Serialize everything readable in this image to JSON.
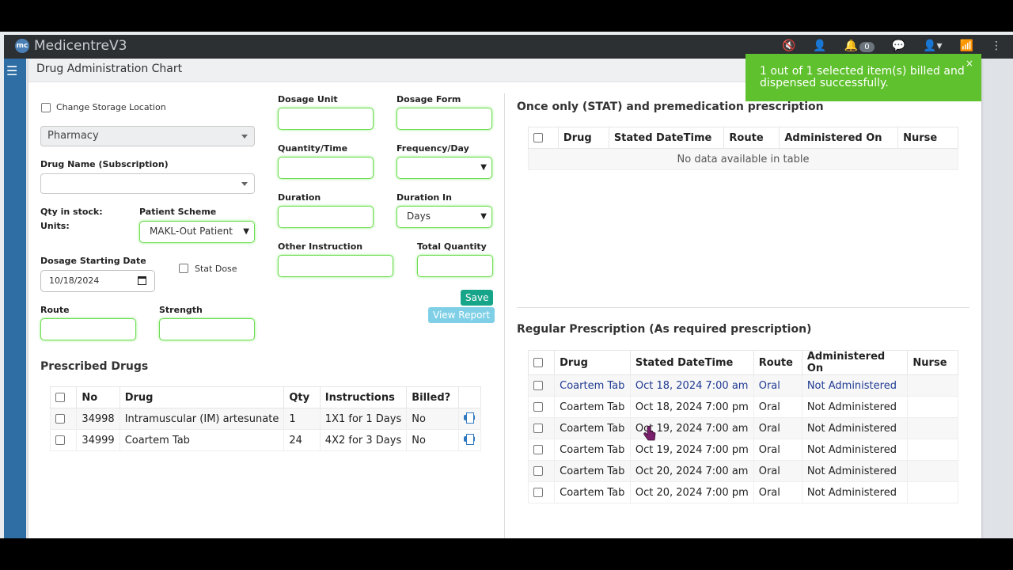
{
  "app": {
    "title": "MedicentreV3",
    "logo_text": "mc",
    "notification_count": "0"
  },
  "modal": {
    "title": "Drug Administration Chart"
  },
  "form": {
    "change_storage_label": "Change Storage Location",
    "store_value": "Pharmacy",
    "drug_name_label": "Drug Name (Subscription)",
    "qty_in_stock_label": "Qty in stock:",
    "units_label": "Units:",
    "patient_scheme_label": "Patient Scheme",
    "patient_scheme_value": "MAKL-Out Patient",
    "dosage_start_label": "Dosage Starting Date",
    "dosage_start_value": "10/18/2024",
    "stat_dose_label": "Stat Dose",
    "route_label": "Route",
    "strength_label": "Strength",
    "dosage_unit_label": "Dosage Unit",
    "dosage_form_label": "Dosage Form",
    "quantity_time_label": "Quantity/Time",
    "frequency_label": "Frequency/Day",
    "duration_label": "Duration",
    "duration_in_label": "Duration In",
    "duration_in_value": "Days",
    "other_instruction_label": "Other Instruction",
    "total_quantity_label": "Total Quantity",
    "save_label": "Save",
    "view_report_label": "View Report"
  },
  "prescribed": {
    "title": "Prescribed Drugs",
    "headers": [
      "No",
      "Drug",
      "Qty",
      "Instructions",
      "Billed?"
    ],
    "rows": [
      {
        "no": "34998",
        "drug": "Intramuscular (IM) artesunate",
        "qty": "1",
        "instructions": "1X1 for 1 Days",
        "billed": "No"
      },
      {
        "no": "34999",
        "drug": "Coartem Tab",
        "qty": "24",
        "instructions": "4X2 for 3 Days",
        "billed": "No"
      }
    ]
  },
  "stat": {
    "title": "Once only (STAT) and premedication prescription",
    "headers": [
      "Drug",
      "Stated DateTime",
      "Route",
      "Administered On",
      "Nurse"
    ],
    "empty_text": "No data available in table"
  },
  "regular": {
    "title": "Regular Prescription (As required prescription)",
    "headers": [
      "Drug",
      "Stated DateTime",
      "Route",
      "Administered On",
      "Nurse"
    ],
    "rows": [
      {
        "drug": "Coartem Tab",
        "datetime": "Oct 18, 2024 7:00 am",
        "route": "Oral",
        "administered": "Not Administered",
        "nurse": ""
      },
      {
        "drug": "Coartem Tab",
        "datetime": "Oct 18, 2024 7:00 pm",
        "route": "Oral",
        "administered": "Not Administered",
        "nurse": ""
      },
      {
        "drug": "Coartem Tab",
        "datetime": "Oct 19, 2024 7:00 am",
        "route": "Oral",
        "administered": "Not Administered",
        "nurse": ""
      },
      {
        "drug": "Coartem Tab",
        "datetime": "Oct 19, 2024 7:00 pm",
        "route": "Oral",
        "administered": "Not Administered",
        "nurse": ""
      },
      {
        "drug": "Coartem Tab",
        "datetime": "Oct 20, 2024 7:00 am",
        "route": "Oral",
        "administered": "Not Administered",
        "nurse": ""
      },
      {
        "drug": "Coartem Tab",
        "datetime": "Oct 20, 2024 7:00 pm",
        "route": "Oral",
        "administered": "Not Administered",
        "nurse": ""
      }
    ]
  },
  "toast": {
    "message": "1 out of 1 selected item(s) billed and dispensed successfully.",
    "close": "×"
  },
  "colors": {
    "accent_green": "#6fdc52",
    "save": "#17a589",
    "toast": "#5fc12d"
  }
}
